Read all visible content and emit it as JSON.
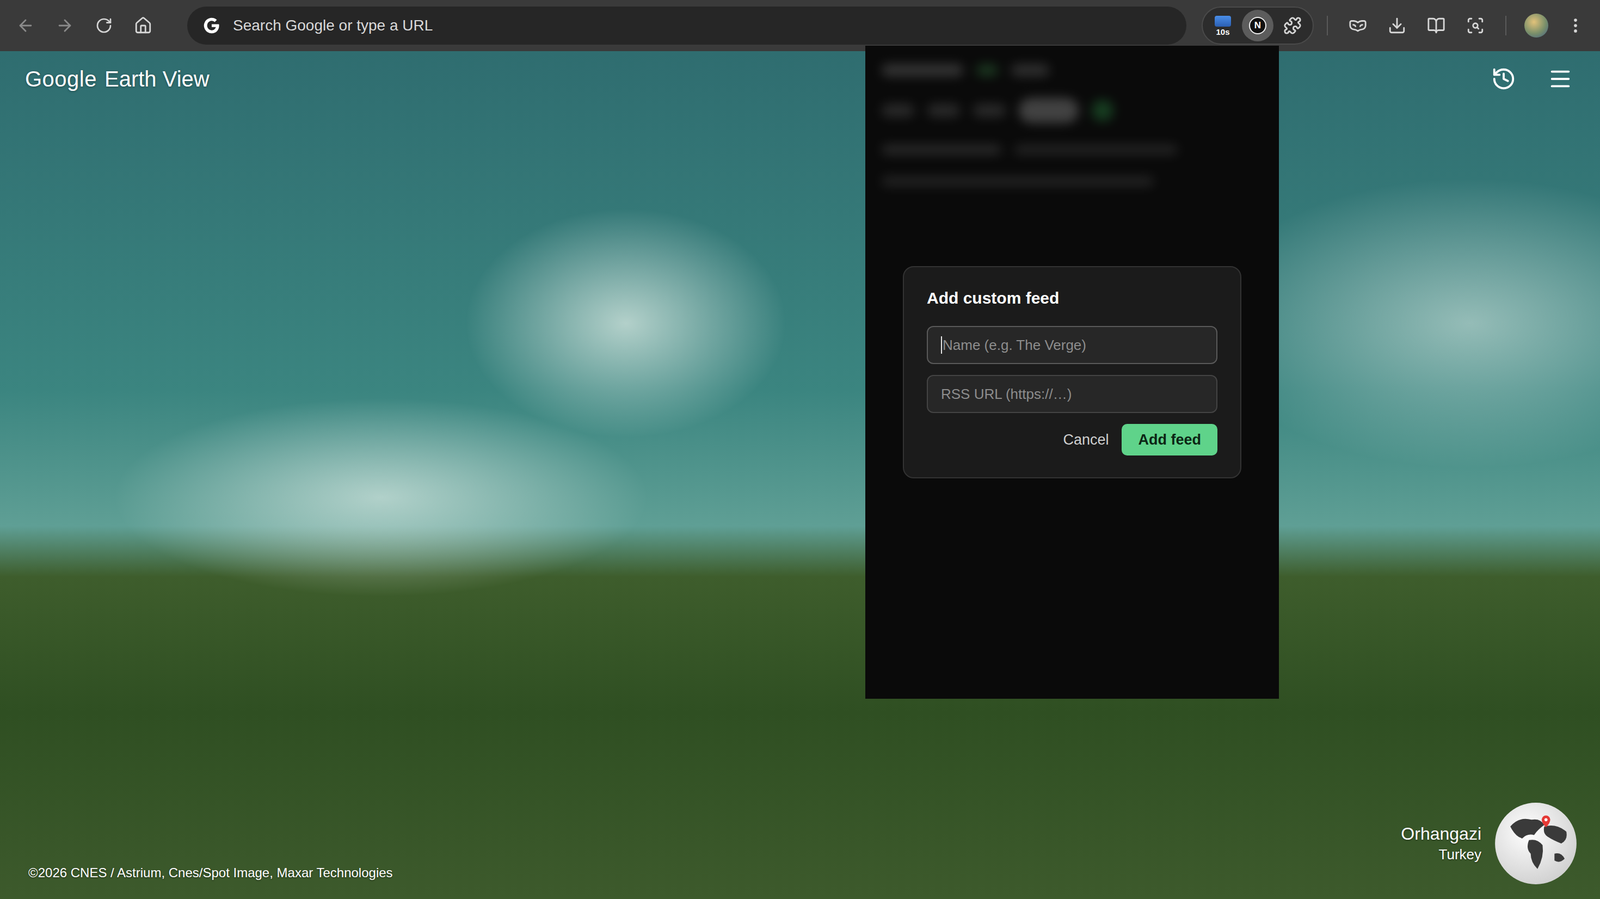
{
  "browser": {
    "address_placeholder": "Search Google or type a URL",
    "extensions": [
      {
        "label": "10s",
        "active": false
      },
      {
        "label": "N",
        "active": true
      }
    ]
  },
  "page": {
    "logo": {
      "brand": "Google",
      "product": "Earth View"
    },
    "location": {
      "place": "Orhangazi",
      "country": "Turkey"
    },
    "copyright": "©2026 CNES / Astrium, Cnes/Spot Image, Maxar Technologies"
  },
  "dialog": {
    "title": "Add custom feed",
    "fields": [
      {
        "placeholder": "Name (e.g. The Verge)",
        "focused": true
      },
      {
        "placeholder": "RSS URL (https://…)",
        "focused": false
      }
    ],
    "buttons": [
      {
        "label": "Cancel",
        "primary": false
      },
      {
        "label": "Add feed",
        "primary": true
      }
    ]
  }
}
